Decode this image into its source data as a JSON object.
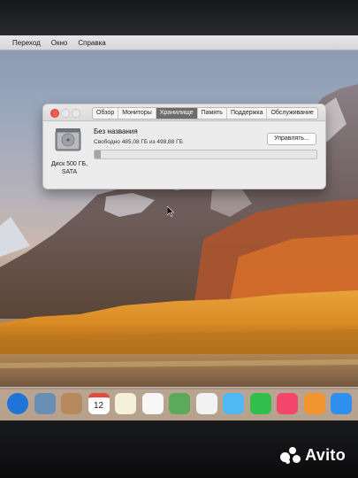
{
  "menubar": {
    "items": [
      "",
      "Переход",
      "Окно",
      "Справка"
    ]
  },
  "window": {
    "tabs": [
      {
        "label": "Обзор",
        "active": false
      },
      {
        "label": "Мониторы",
        "active": false
      },
      {
        "label": "Хранилище",
        "active": true
      },
      {
        "label": "Память",
        "active": false
      },
      {
        "label": "Поддержка",
        "active": false
      },
      {
        "label": "Обслуживание",
        "active": false
      }
    ],
    "disk": {
      "label_line1": "Диск 500 ГБ,",
      "label_line2": "SATA"
    },
    "volume": {
      "name": "Без названия",
      "free_text": "Свободно 485,08 ГБ из 498,88 ГБ",
      "used_fraction": 0.028
    },
    "manage_button": "Управлять..."
  },
  "dock": {
    "icons": [
      {
        "name": "safari-icon",
        "color": "#1e74d8"
      },
      {
        "name": "photo-browser-icon",
        "color": "#6a8fb5"
      },
      {
        "name": "contacts-icon",
        "color": "#b68a5c"
      },
      {
        "name": "calendar-icon",
        "color": "#ffffff",
        "text": "12"
      },
      {
        "name": "notes-icon",
        "color": "#f5f0d8"
      },
      {
        "name": "reminders-icon",
        "color": "#f7f7f7"
      },
      {
        "name": "maps-icon",
        "color": "#5ba95a"
      },
      {
        "name": "photos-icon",
        "color": "#f2f2f2"
      },
      {
        "name": "messages-icon",
        "color": "#4fb9f5"
      },
      {
        "name": "facetime-icon",
        "color": "#2fbf4a"
      },
      {
        "name": "itunes-icon",
        "color": "#f4466a"
      },
      {
        "name": "ibooks-icon",
        "color": "#f29530"
      },
      {
        "name": "app-store-icon",
        "color": "#2f8ff0"
      }
    ]
  },
  "watermark": {
    "text": "Avito"
  }
}
